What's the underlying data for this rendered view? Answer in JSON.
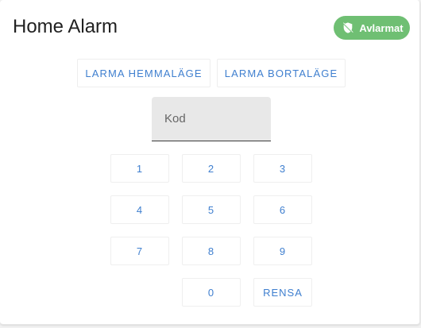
{
  "card": {
    "title": "Home Alarm",
    "status_badge": {
      "label": "Avlarmat",
      "icon": "shield-off-icon",
      "color": "#6fbf73"
    }
  },
  "modes": {
    "home_label": "LARMA HEMMALÄGE",
    "away_label": "LARMA BORTALÄGE"
  },
  "code_input": {
    "placeholder": "Kod",
    "value": ""
  },
  "keypad": {
    "keys": [
      "1",
      "2",
      "3",
      "4",
      "5",
      "6",
      "7",
      "8",
      "9",
      "0"
    ],
    "clear_label": "RENSA"
  },
  "colors": {
    "accent": "#3f7fcf",
    "badge": "#6fbf73",
    "field_bg": "#e8e8e8"
  }
}
